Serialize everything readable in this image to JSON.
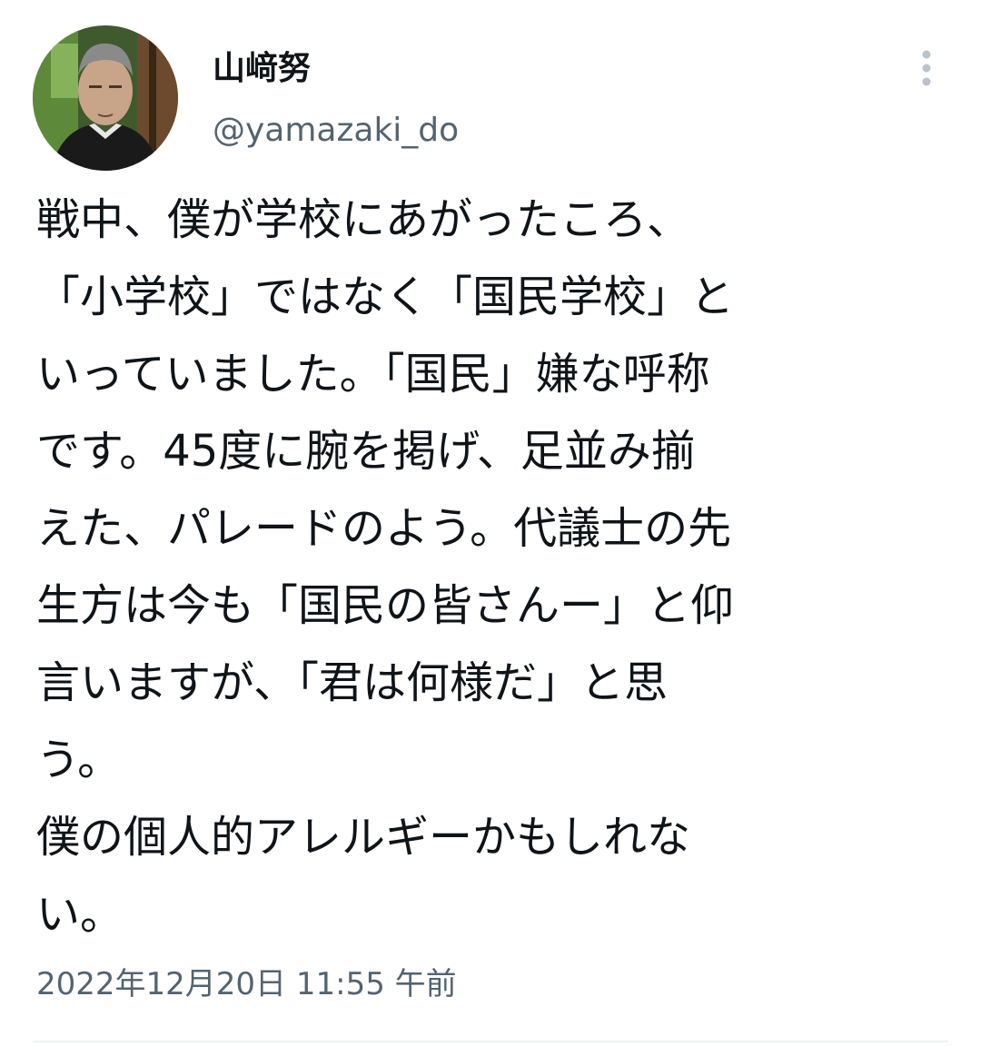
{
  "author": {
    "display_name": "山﨑努",
    "handle": "@yamazaki_do",
    "avatar_icon": "profile-photo"
  },
  "more_menu": {
    "icon": "vertical-ellipsis-icon"
  },
  "tweet": {
    "lines": [
      "戦中、僕が学校にあがったころ、",
      "「小学校」ではなく「国民学校」と",
      "いっていました。「国民」嫌な呼称",
      "です。45度に腕を掲げ、足並み揃",
      "えた、パレードのよう。代議士の先",
      "生方は今も「国民の皆さんー」と仰",
      "言いますが、「君は何様だ」と思",
      "う。",
      "僕の個人的アレルギーかもしれな",
      "い。"
    ]
  },
  "timestamp": "2022年12月20日 11:55 午前",
  "colors": {
    "text_primary": "#0f1419",
    "text_secondary": "#536471",
    "divider": "#eff3f4"
  }
}
